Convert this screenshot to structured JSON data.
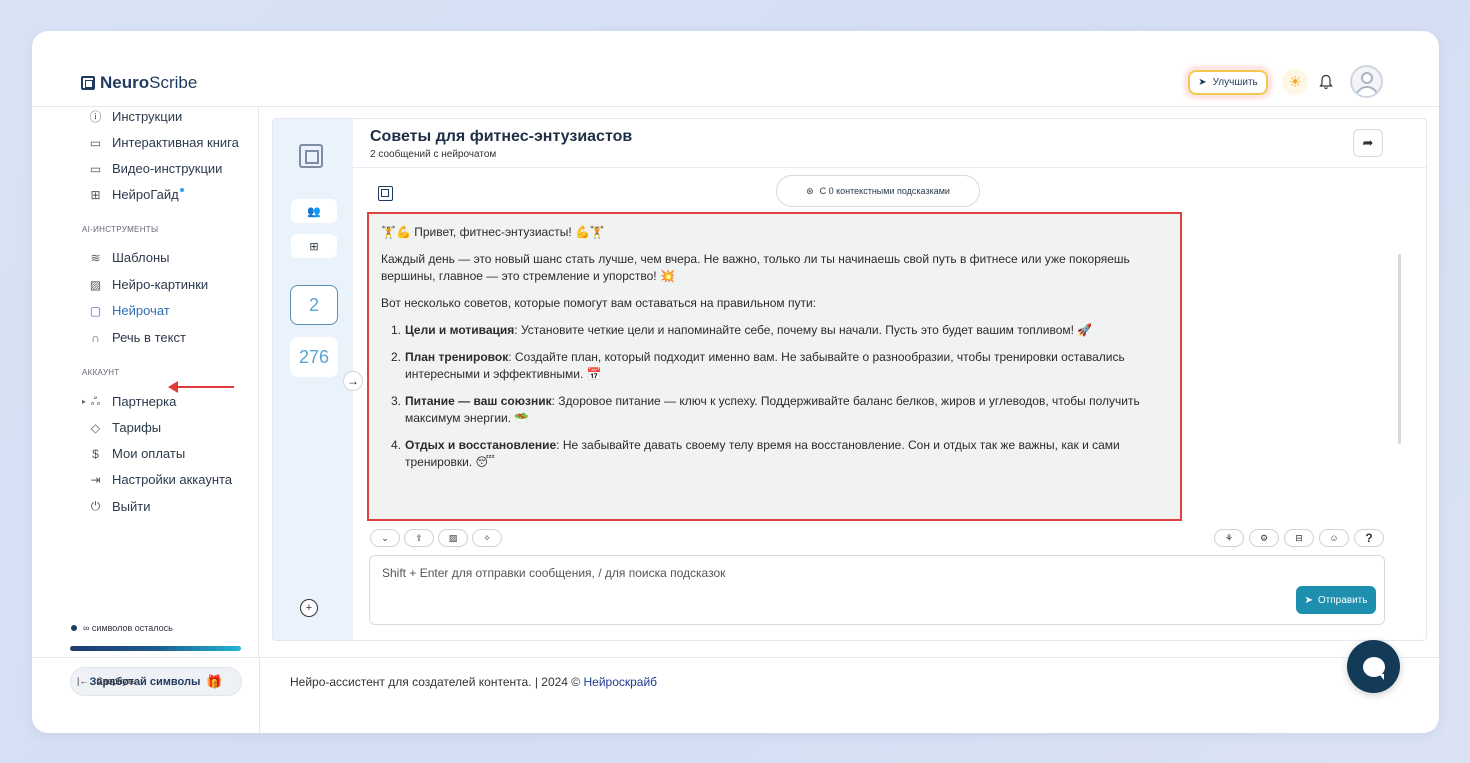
{
  "header": {
    "logo_bold": "Neuro",
    "logo_rest": "Scribe",
    "upgrade_label": "Улучшить",
    "icons": [
      "rocket-icon",
      "sun-icon",
      "bell-icon",
      "avatar"
    ]
  },
  "sidebar": {
    "items_top": [
      {
        "label": "Инструкции",
        "icon": "question-circle-icon"
      },
      {
        "label": "Интерактивная книга",
        "icon": "book-icon"
      },
      {
        "label": "Видео-инструкции",
        "icon": "video-icon"
      },
      {
        "label": "НейроГайд",
        "icon": "guide-icon"
      }
    ],
    "section_ai": "AI-ИНСТРУМЕНТЫ",
    "items_ai": [
      {
        "label": "Шаблоны",
        "icon": "layers-icon"
      },
      {
        "label": "Нейро-картинки",
        "icon": "image-icon"
      },
      {
        "label": "Нейрочат",
        "icon": "chat-icon"
      },
      {
        "label": "Речь в текст",
        "icon": "headphones-icon"
      }
    ],
    "section_account": "АККАУНТ",
    "items_account": [
      {
        "label": "Партнерка",
        "icon": "users-icon"
      },
      {
        "label": "Тарифы",
        "icon": "tag-icon"
      },
      {
        "label": "Мои оплаты",
        "icon": "dollar-icon"
      },
      {
        "label": "Настройки аккаунта",
        "icon": "login-icon"
      },
      {
        "label": "Выйти",
        "icon": "power-icon"
      }
    ],
    "symbols_left": "∞ символов осталось",
    "earn_button": "Заработай символы",
    "collapse_label": "Свернуть"
  },
  "chat": {
    "rail_counts": [
      "2",
      "276"
    ],
    "title": "Советы для фитнес-энтузиастов",
    "subtitle": "2 сообщений с нейрочатом",
    "hints_pill": "С 0 контекстными подсказками",
    "message": {
      "greeting": "🏋️💪 Привет, фитнес-энтузиасты! 💪🏋️",
      "para1": "Каждый день — это новый шанс стать лучше, чем вчера. Не важно, только ли ты начинаешь свой путь в фитнесе или уже покоряешь вершины, главное — это стремление и упорство! 💥",
      "para2": "Вот несколько советов, которые помогут вам оставаться на правильном пути:",
      "tips": [
        {
          "num": "1.",
          "title": "Цели и мотивация",
          "text": ": Установите четкие цели и напоминайте себе, почему вы начали. Пусть это будет вашим топливом! 🚀"
        },
        {
          "num": "2.",
          "title": "План тренировок",
          "text": ": Создайте план, который подходит именно вам. Не забывайте о разнообразии, чтобы тренировки оставались интересными и эффективными. 📅"
        },
        {
          "num": "3.",
          "title": "Питание — ваш союзник",
          "text": ": Здоровое питание — ключ к успеху. Поддерживайте баланс белков, жиров и углеводов, чтобы получить максимум энергии. 🥗"
        },
        {
          "num": "4.",
          "title": "Отдых и восстановление",
          "text": ": Не забывайте давать своему телу время на восстановление. Сон и отдых так же важны, как и сами тренировки. 😴"
        }
      ]
    },
    "input_placeholder": "Shift + Enter для отправки сообщения, / для поиска подсказок",
    "send_label": "Отправить",
    "help_label": "?"
  },
  "footer": {
    "text": "Нейро-ассистент для создателей контента.  | 2024 © ",
    "brand": "Нейроскрайб"
  },
  "colors": {
    "accent": "#1f8fb0",
    "highlight_border": "#e0403f",
    "active_link": "#2f6db5",
    "fab": "#133a57"
  }
}
